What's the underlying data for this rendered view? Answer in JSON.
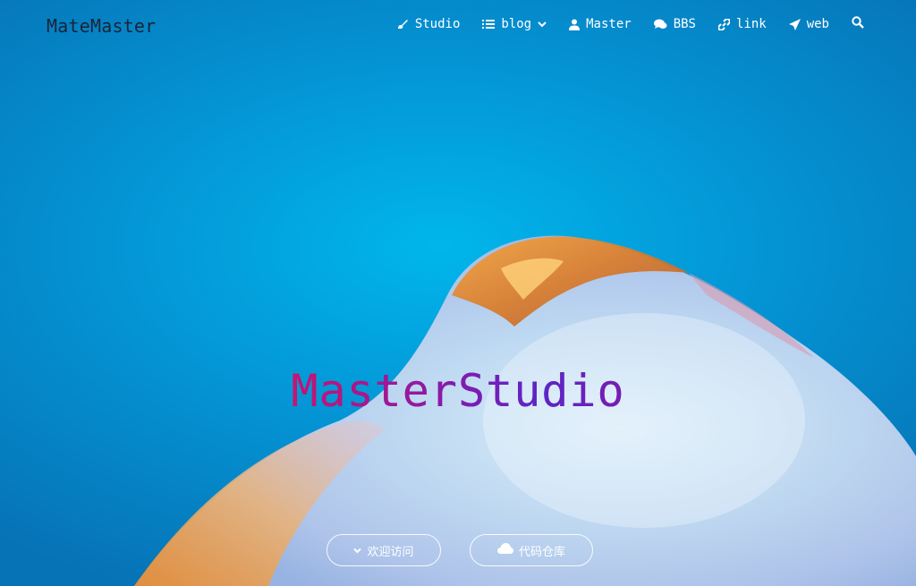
{
  "brand": {
    "name": "MateMaster"
  },
  "nav": {
    "items": [
      {
        "label": "Studio",
        "icon": "palette-icon"
      },
      {
        "label": "blog",
        "icon": "list-icon",
        "has_dropdown": true
      },
      {
        "label": "Master",
        "icon": "user-icon"
      },
      {
        "label": "BBS",
        "icon": "comments-icon"
      },
      {
        "label": "link",
        "icon": "link-icon"
      },
      {
        "label": "web",
        "icon": "paper-plane-icon"
      }
    ],
    "search_icon": "search-icon"
  },
  "hero": {
    "title": "MasterStudio",
    "buttons": [
      {
        "label": "欢迎访问",
        "icon": "chevron-down-icon"
      },
      {
        "label": "代码仓库",
        "icon": "cloud-icon"
      }
    ]
  },
  "colors": {
    "background_blue": "#0496d6",
    "brand_text": "#1a2438",
    "title_gradient_start": "#c8146e",
    "title_gradient_end": "#5a26c8",
    "nav_text": "#ffffff"
  }
}
